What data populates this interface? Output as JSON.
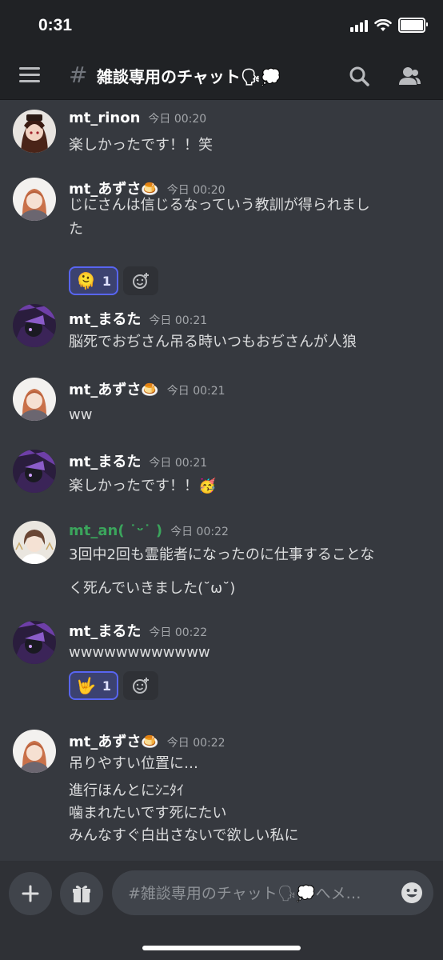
{
  "status_bar": {
    "time": "0:31"
  },
  "header": {
    "channel_name": "雑談専用のチャット🗣💭",
    "icons": [
      "hamburger-icon",
      "hash-icon",
      "search-icon",
      "members-icon"
    ]
  },
  "messages": [
    {
      "username": "mt_rinon",
      "timestamp": "今日 00:20",
      "lines": [
        "楽しかったです！！笑"
      ]
    },
    {
      "username": "mt_あずさ🍮",
      "timestamp": "今日 00:20",
      "lines": [
        "じにさんは信じるなっていう教訓が得られまし",
        "た"
      ],
      "reaction": {
        "emoji": "🫠",
        "count": "1"
      }
    },
    {
      "username": "mt_まるた",
      "timestamp": "今日 00:21",
      "lines": [
        "脳死でおぢさん吊る時いつもおぢさんが人狼"
      ]
    },
    {
      "username": "mt_あずさ🍮",
      "timestamp": "今日 00:21",
      "lines": [
        "ww"
      ]
    },
    {
      "username": "mt_まるた",
      "timestamp": "今日 00:21",
      "lines": [
        "楽しかったです！！🥳"
      ]
    },
    {
      "username": "mt_an(  ˙ᵕ˙  )",
      "timestamp": "今日 00:22",
      "lines": [
        "3回中2回も霊能者になったのに仕事することな",
        "く死んでいきました(˘ω˘)"
      ]
    },
    {
      "username": "mt_まるた",
      "timestamp": "今日 00:22",
      "lines": [
        "wwwwwwwwwwww"
      ],
      "reaction": {
        "emoji": "🤟",
        "count": "1"
      }
    },
    {
      "username": "mt_あずさ🍮",
      "timestamp": "今日 00:22",
      "lines": [
        "吊りやすい位置に…",
        "進行ほんとにｼﾆﾀｲ",
        "噛まれたいです死にたい",
        "みんなすぐ白出さないで欲しい私に"
      ]
    }
  ],
  "input": {
    "placeholder": "#雑談専用のチャット🗣💭へメ…"
  },
  "colors": {
    "background": "#36393f",
    "header": "#202225",
    "accent": "#5865f2",
    "green_username": "#3ba55c"
  }
}
